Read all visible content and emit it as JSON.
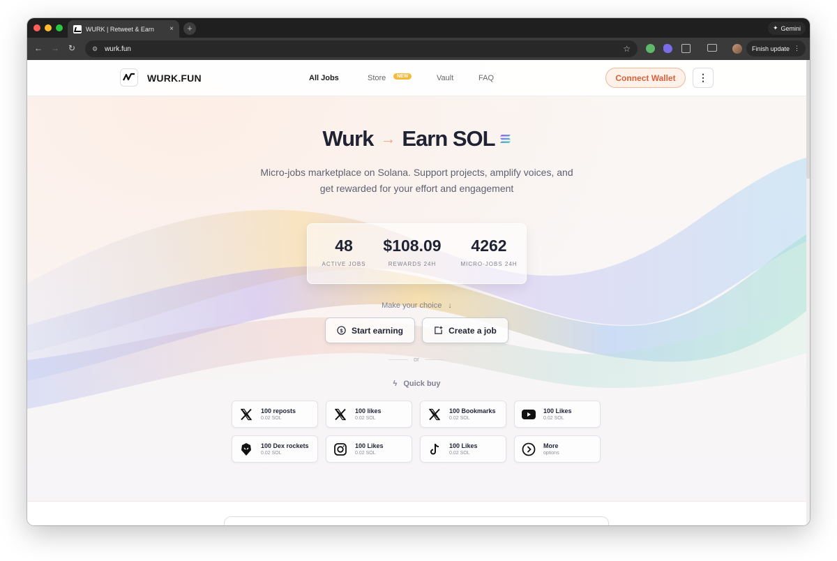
{
  "browser": {
    "tab_title": "WURK | Retweet & Earn",
    "tab_close": "×",
    "new_tab": "+",
    "gemini_label": "Gemini",
    "url": "wurk.fun",
    "finish_update_label": "Finish update"
  },
  "header": {
    "logo_text": "WURK.FUN",
    "nav": [
      {
        "label": "All Jobs"
      },
      {
        "label": "Store",
        "badge": "NEW"
      },
      {
        "label": "Vault"
      },
      {
        "label": "FAQ"
      }
    ],
    "connect_wallet_label": "Connect Wallet",
    "menu_icon": "⋮"
  },
  "hero": {
    "title_left": "Wurk",
    "title_arrow": "→",
    "title_right": "Earn SOL",
    "subtitle": "Micro-jobs marketplace on Solana. Support projects, amplify voices, and get rewarded for your effort and engagement"
  },
  "stats": [
    {
      "value": "48",
      "label": "ACTIVE JOBS"
    },
    {
      "value": "$108.09",
      "label": "REWARDS 24H"
    },
    {
      "value": "4262",
      "label": "MICRO-JOBS 24H"
    }
  ],
  "choice": {
    "prompt": "Make your choice",
    "start_earning_label": "Start earning",
    "create_job_label": "Create a job",
    "or_label": "or",
    "quick_buy_label": "Quick buy"
  },
  "quick_buy": [
    {
      "title": "100 reposts",
      "sub": "0.02 SOL",
      "icon": "x-icon"
    },
    {
      "title": "100 likes",
      "sub": "0.02 SOL",
      "icon": "x-icon"
    },
    {
      "title": "100 Bookmarks",
      "sub": "0.02 SOL",
      "icon": "x-icon"
    },
    {
      "title": "100 Likes",
      "sub": "0.02 SOL",
      "icon": "youtube-icon"
    },
    {
      "title": "100 Dex rockets",
      "sub": "0.02 SOL",
      "icon": "dex-icon"
    },
    {
      "title": "100 Likes",
      "sub": "0.02 SOL",
      "icon": "instagram-icon"
    },
    {
      "title": "100 Likes",
      "sub": "0.02 SOL",
      "icon": "tiktok-icon"
    },
    {
      "title": "More",
      "sub": "options",
      "icon": "chevron-right-circle-icon"
    }
  ],
  "colors": {
    "accent": "#d9603a",
    "title": "#1e2233",
    "badge": "#f7b93a"
  }
}
